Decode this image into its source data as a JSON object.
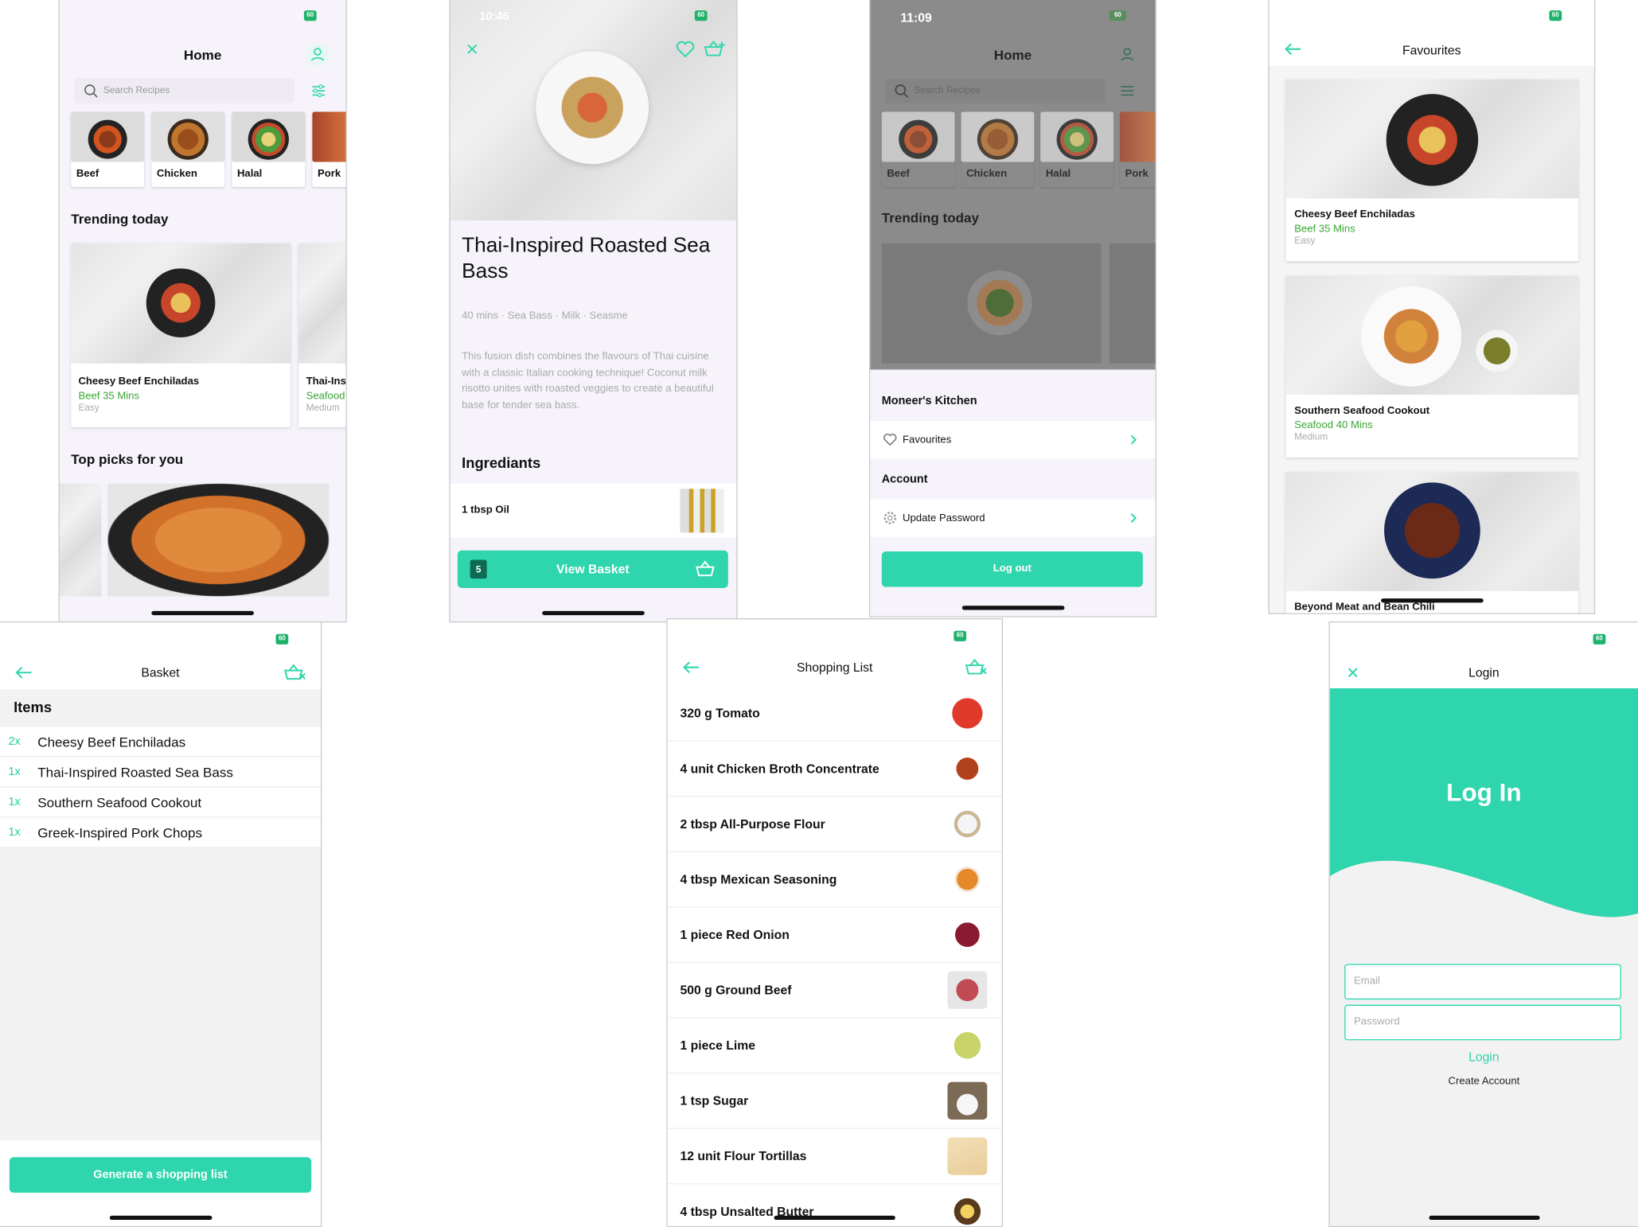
{
  "home": {
    "title": "Home",
    "search_placeholder": "Search Recipes",
    "categories": [
      "Beef",
      "Chicken",
      "Halal",
      "Pork"
    ],
    "trending_title": "Trending today",
    "trending": [
      {
        "name": "Cheesy Beef Enchiladas",
        "meta": "Beef 35 Mins",
        "difficulty": "Easy"
      },
      {
        "name": "Thai-Ins",
        "meta": "Seafood",
        "difficulty": "Medium"
      }
    ],
    "top_picks_title": "Top picks for you"
  },
  "recipe": {
    "status_time": "10:46",
    "title": "Thai-Inspired Roasted Sea Bass",
    "meta": "40 mins · Sea Bass · Milk · Seasme",
    "description": "This fusion dish combines the flavours of Thai cuisine with a classic Italian cooking technique! Coconut milk risotto unites with roasted veggies to create a beautiful base for tender sea bass.",
    "ingredients_title": "Ingrediants",
    "first_ingredient": "1 tbsp Oil",
    "basket_count": "5",
    "view_basket": "View Basket"
  },
  "menu": {
    "status_time": "11:09",
    "title": "Home",
    "search_placeholder": "Search Recipes",
    "categories": [
      "Beef",
      "Chicken",
      "Halal",
      "Pork"
    ],
    "trending_title": "Trending today",
    "kitchen_title": "Moneer's Kitchen",
    "favourites": "Favourites",
    "account_title": "Account",
    "update_password": "Update Password",
    "logout": "Log out"
  },
  "favourites": {
    "title": "Favourites",
    "items": [
      {
        "name": "Cheesy Beef Enchiladas",
        "meta": "Beef 35 Mins",
        "difficulty": "Easy"
      },
      {
        "name": "Southern Seafood Cookout",
        "meta": "Seafood 40 Mins",
        "difficulty": "Medium"
      },
      {
        "name": "Beyond Meat and Bean Chili"
      }
    ]
  },
  "basket": {
    "title": "Basket",
    "items_header": "Items",
    "items": [
      {
        "qty": "2x",
        "name": "Cheesy Beef Enchiladas"
      },
      {
        "qty": "1x",
        "name": "Thai-Inspired Roasted Sea Bass"
      },
      {
        "qty": "1x",
        "name": "Southern Seafood Cookout"
      },
      {
        "qty": "1x",
        "name": "Greek-Inspired Pork Chops"
      }
    ],
    "generate_button": "Generate a shopping list"
  },
  "shopping": {
    "title": "Shopping List",
    "items": [
      "320 g Tomato",
      "4 unit Chicken Broth Concentrate",
      "2 tbsp All-Purpose Flour",
      "4 tbsp Mexican Seasoning",
      "1 piece Red Onion",
      "500 g Ground Beef",
      "1 piece Lime",
      "1 tsp Sugar",
      "12 unit Flour Tortillas",
      "4 tbsp Unsalted Butter"
    ]
  },
  "login": {
    "title": "Login",
    "heading": "Log In",
    "email_placeholder": "Email",
    "password_placeholder": "Password",
    "login_link": "Login",
    "create_account": "Create Account"
  },
  "colors": {
    "accent": "#2fd6ad",
    "green_text": "#3aa635",
    "battery": "#1fb26b"
  }
}
